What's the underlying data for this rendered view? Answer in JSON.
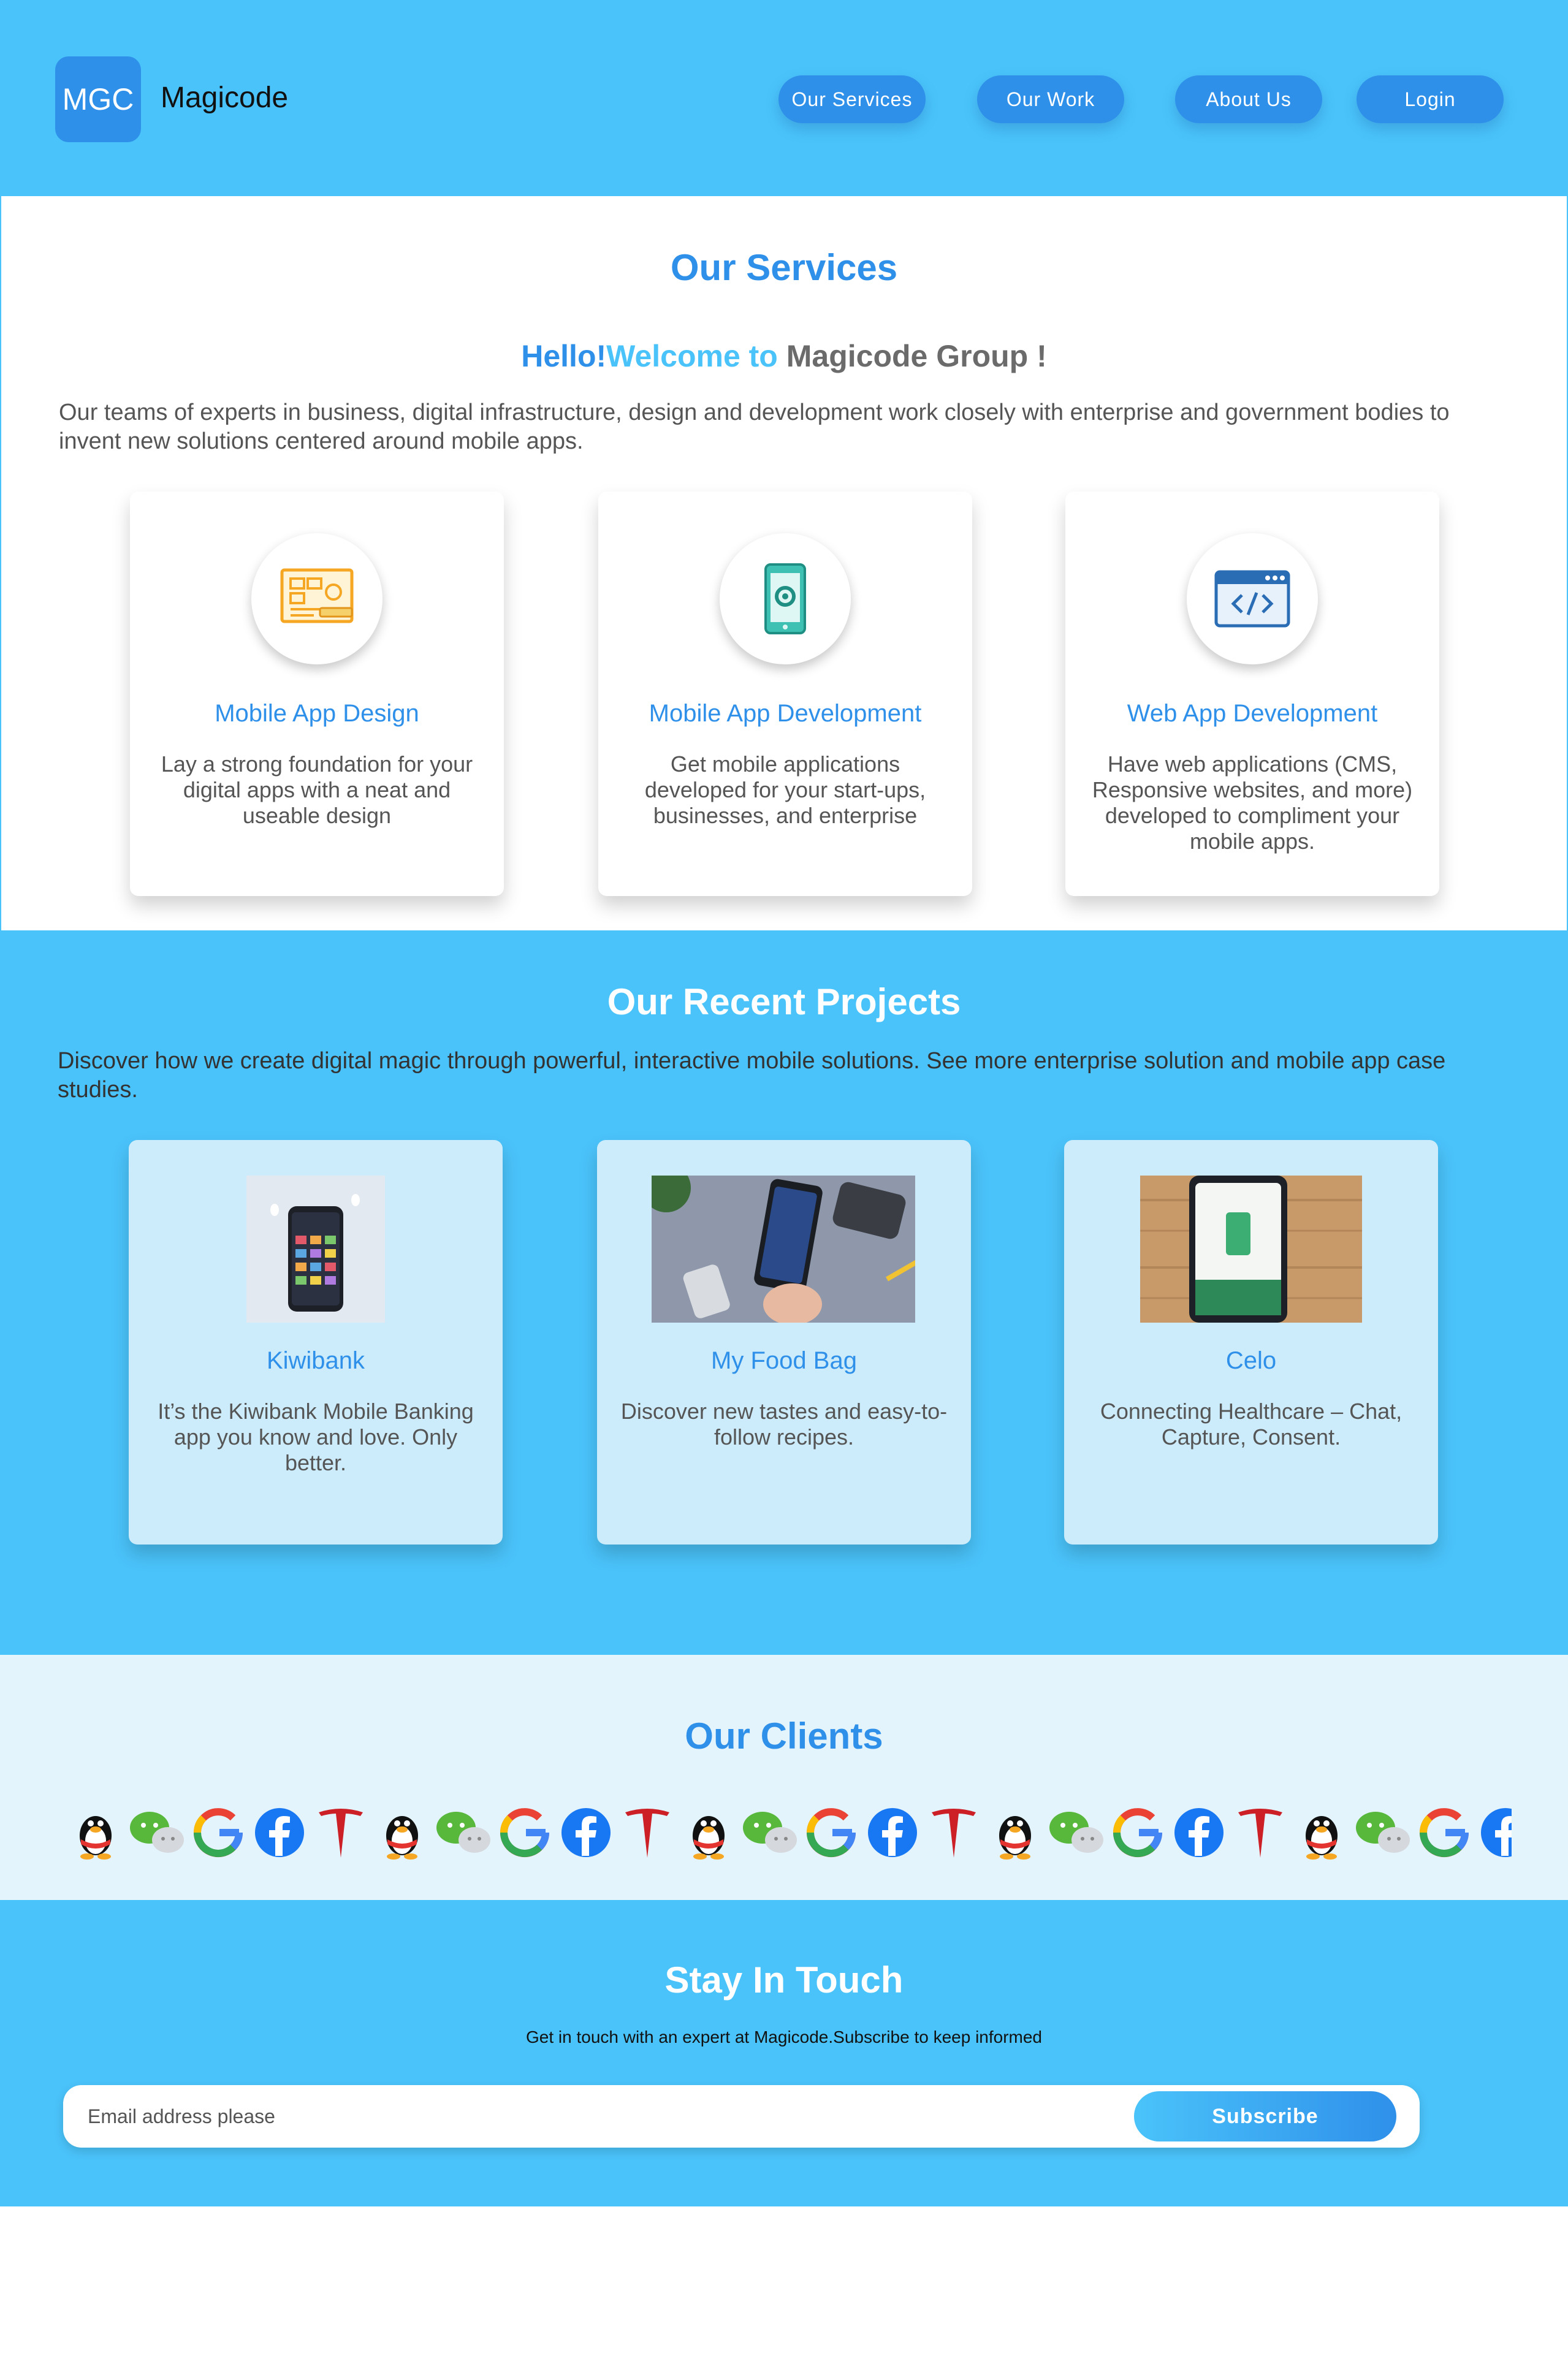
{
  "header": {
    "logo_text": "MGC",
    "brand_name": "Magicode",
    "nav": {
      "services": "Our Services",
      "work": "Our Work",
      "about": "About Us",
      "login": "Login"
    }
  },
  "services": {
    "title": "Our Services",
    "hello": "Hello!",
    "welcome": "Welcome to",
    "group": "Magicode Group !",
    "intro": "Our teams of experts in business, digital infrastructure, design and development work closely with enterprise and government bodies to invent new solutions centered around mobile apps.",
    "cards": [
      {
        "icon": "design-blueprint-icon",
        "title": "Mobile App Design",
        "desc": "Lay a strong foundation for your digital apps with a neat and useable design"
      },
      {
        "icon": "mobile-settings-icon",
        "title": "Mobile App Development",
        "desc": "Get mobile applications developed for your start-ups, businesses, and enterprise"
      },
      {
        "icon": "code-window-icon",
        "title": "Web App Development",
        "desc": "Have web applications (CMS, Responsive websites, and more) developed to compliment your mobile apps."
      }
    ]
  },
  "projects": {
    "title": "Our Recent Projects",
    "intro": "Discover how we create digital magic through powerful, interactive mobile solutions. See more enterprise solution and mobile app case studies.",
    "cards": [
      {
        "title": "Kiwibank",
        "desc": "It’s the Kiwibank Mobile Banking app you know and love. Only better."
      },
      {
        "title": "My Food Bag",
        "desc": "Discover new tastes and easy-to-follow recipes."
      },
      {
        "title": "Celo",
        "desc": "Connecting Healthcare – Chat, Capture, Consent."
      }
    ]
  },
  "clients": {
    "title": "Our Clients",
    "logos": [
      "qq-penguin-icon",
      "wechat-icon",
      "google-icon",
      "facebook-icon",
      "tesla-icon"
    ]
  },
  "touch": {
    "title": "Stay In Touch",
    "subtitle": "Get in touch with an expert at Magicode.Subscribe to keep informed",
    "email_placeholder": "Email address please",
    "subscribe_label": "Subscribe"
  },
  "colors": {
    "primary": "#2f90ea",
    "accent": "#4ac3fa",
    "card_light": "#ccecfb",
    "clients_bg": "#e3f4fd"
  }
}
